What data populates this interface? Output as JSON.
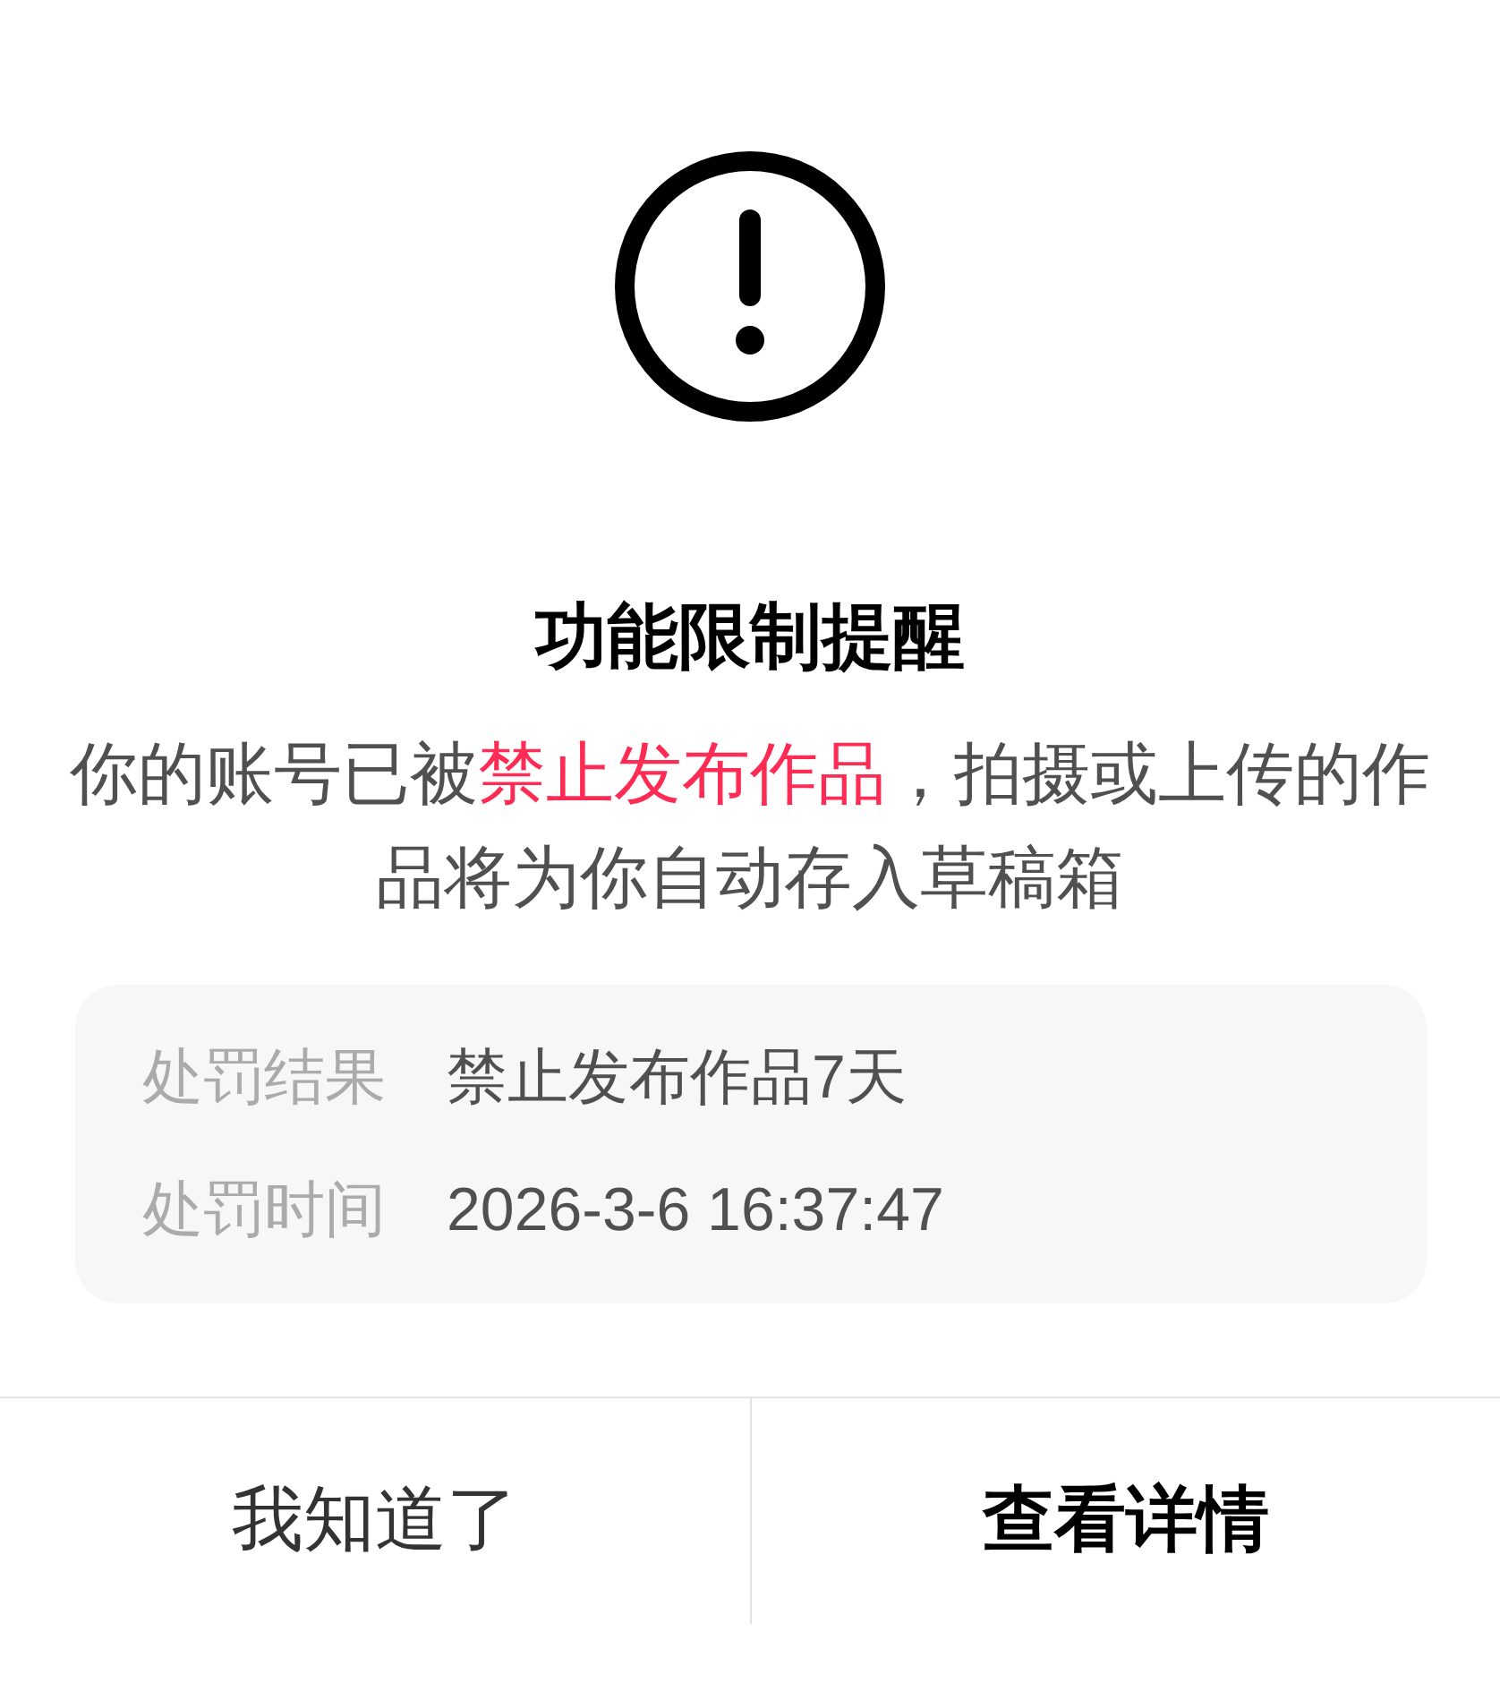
{
  "dialog": {
    "title": "功能限制提醒",
    "message": [
      {
        "text": "你的账号已被",
        "highlight": false
      },
      {
        "text": "禁止发布作品",
        "highlight": true
      },
      {
        "text": "，拍摄或上传的作品将为你自动存入草稿箱",
        "highlight": false
      }
    ],
    "details": [
      {
        "label": "处罚结果",
        "value": "禁止发布作品7天"
      },
      {
        "label": "处罚时间",
        "value": "2026-3-6 16:37:47"
      }
    ],
    "buttons": [
      {
        "label": "我知道了",
        "primary": false
      },
      {
        "label": "查看详情",
        "primary": true
      }
    ]
  }
}
